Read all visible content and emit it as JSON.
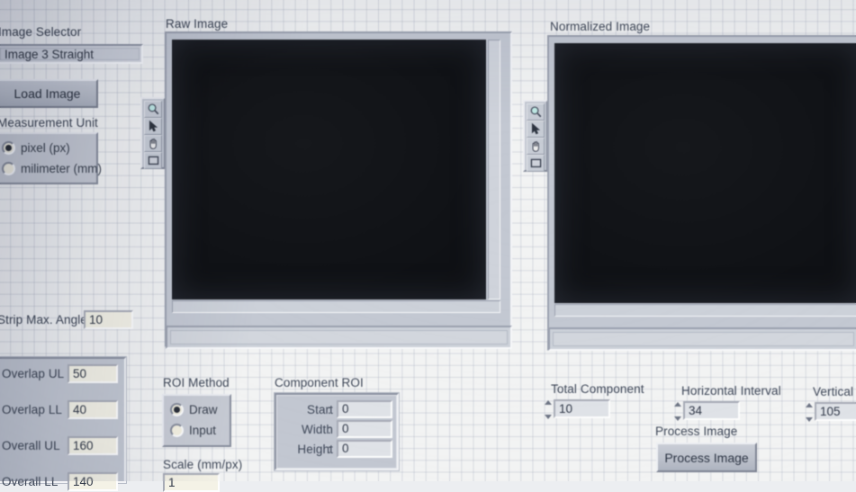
{
  "app": {
    "style": "labview-front-panel",
    "background_color": "#f2f3f3",
    "accent_text_color": "#3d4657"
  },
  "image_selector": {
    "label": "Image Selector",
    "value": "Image 3 Straight",
    "load_button": "Load Image"
  },
  "measurement_unit": {
    "label": "Measurement Unit",
    "options": [
      {
        "label": "pixel (px)",
        "selected": true
      },
      {
        "label": "milimeter (mm)",
        "selected": false
      }
    ]
  },
  "strip": {
    "label": "Strip Max. Angle",
    "value": "10"
  },
  "limits": {
    "rows": [
      {
        "label": "Overlap UL",
        "value": "50"
      },
      {
        "label": "Overlap LL",
        "value": "40"
      },
      {
        "label": "Overall UL",
        "value": "160"
      },
      {
        "label": "Overall LL",
        "value": "140"
      }
    ]
  },
  "raw_image": {
    "label": "Raw Image",
    "tools": [
      "magnifier-icon",
      "cursor-arrow-icon",
      "pan-hand-icon",
      "rectangle-roi-icon"
    ]
  },
  "normalized_image": {
    "label": "Normalized Image",
    "tools": [
      "magnifier-icon",
      "cursor-arrow-icon",
      "pan-hand-icon",
      "rectangle-roi-icon"
    ]
  },
  "roi_method": {
    "label": "ROI Method",
    "options": [
      {
        "label": "Draw",
        "selected": true
      },
      {
        "label": "Input",
        "selected": false
      }
    ]
  },
  "scale": {
    "label": "Scale (mm/px)",
    "value": "1"
  },
  "component_roi": {
    "label": "Component ROI",
    "separator": ":",
    "rows": [
      {
        "label": "Start",
        "value": "0"
      },
      {
        "label": "Width",
        "value": "0"
      },
      {
        "label": "Height",
        "value": "0"
      }
    ]
  },
  "total_component": {
    "label": "Total Component",
    "value": "10"
  },
  "horizontal_interval": {
    "label": "Horizontal Interval",
    "value": "34"
  },
  "vertical_interval": {
    "label": "Vertical I",
    "value": "105"
  },
  "process_image": {
    "label": "Process Image",
    "button": "Process Image"
  }
}
